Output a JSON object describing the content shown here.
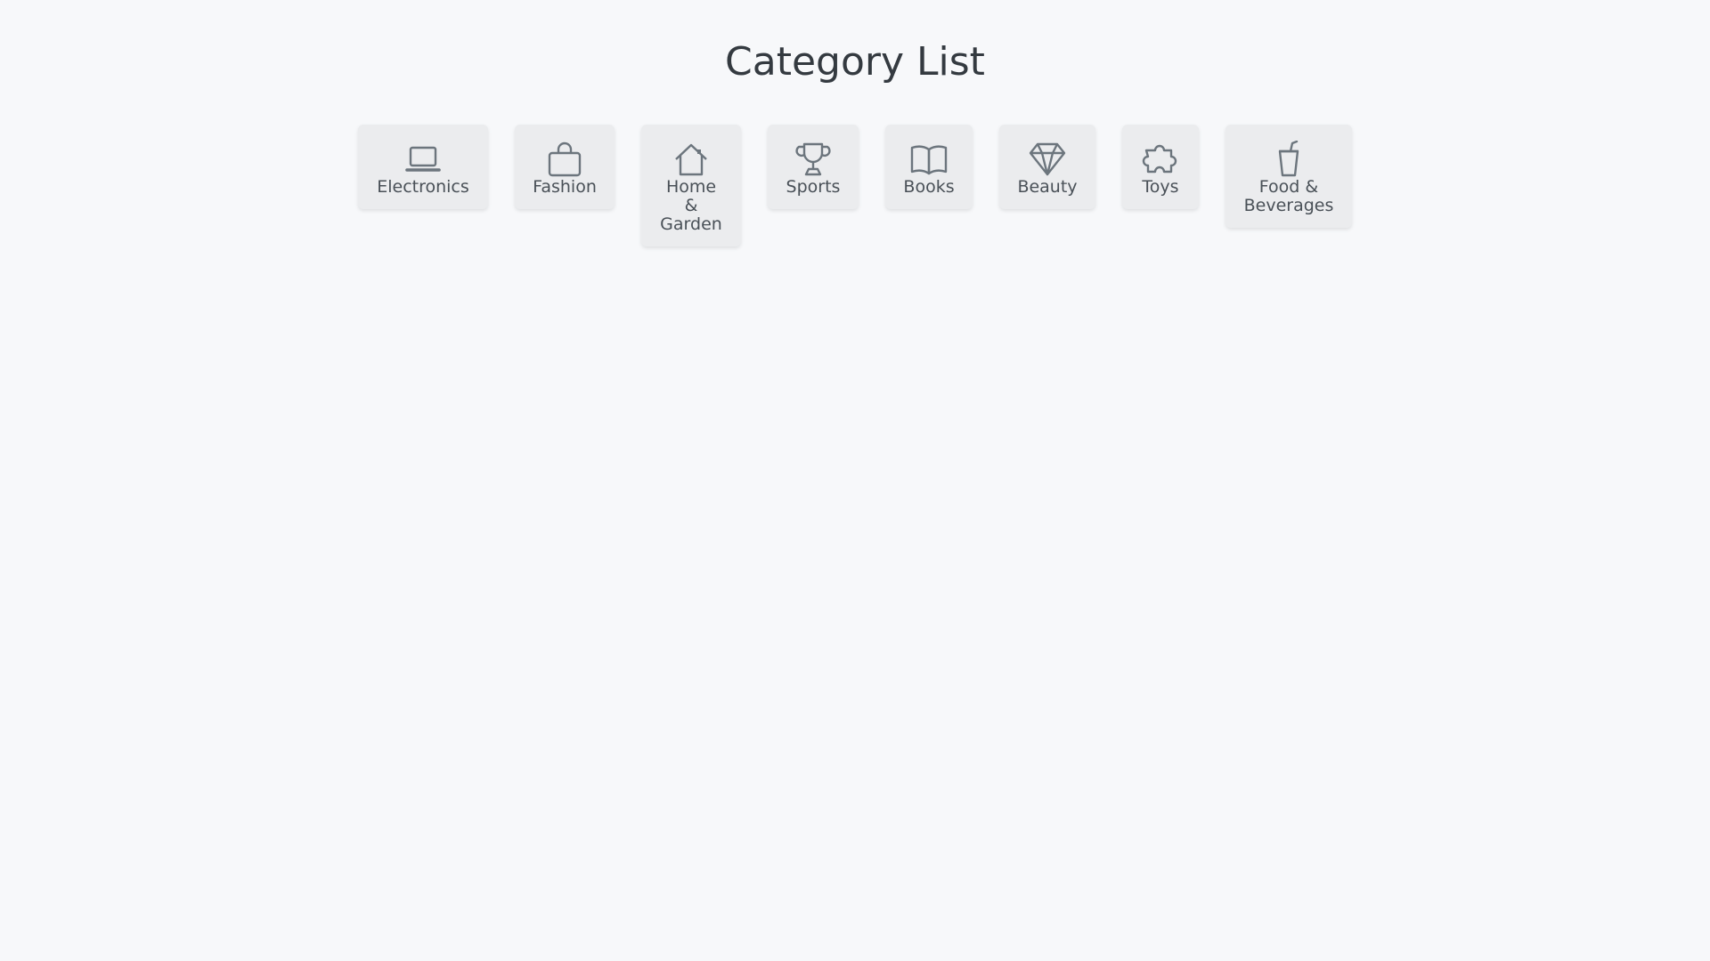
{
  "page": {
    "title": "Category List"
  },
  "categories": [
    {
      "label": "Electronics",
      "icon": "laptop-icon"
    },
    {
      "label": "Fashion",
      "icon": "shopping-bag-icon"
    },
    {
      "label": "Home & Garden",
      "icon": "house-icon"
    },
    {
      "label": "Sports",
      "icon": "trophy-icon"
    },
    {
      "label": "Books",
      "icon": "open-book-icon"
    },
    {
      "label": "Beauty",
      "icon": "gem-icon"
    },
    {
      "label": "Toys",
      "icon": "puzzle-icon"
    },
    {
      "label": "Food & Beverages",
      "icon": "cup-straw-icon"
    }
  ],
  "colors": {
    "background": "#f7f8fa",
    "card": "#ebecee",
    "icon": "#6c757d",
    "label": "#495057",
    "title": "#343a40"
  }
}
